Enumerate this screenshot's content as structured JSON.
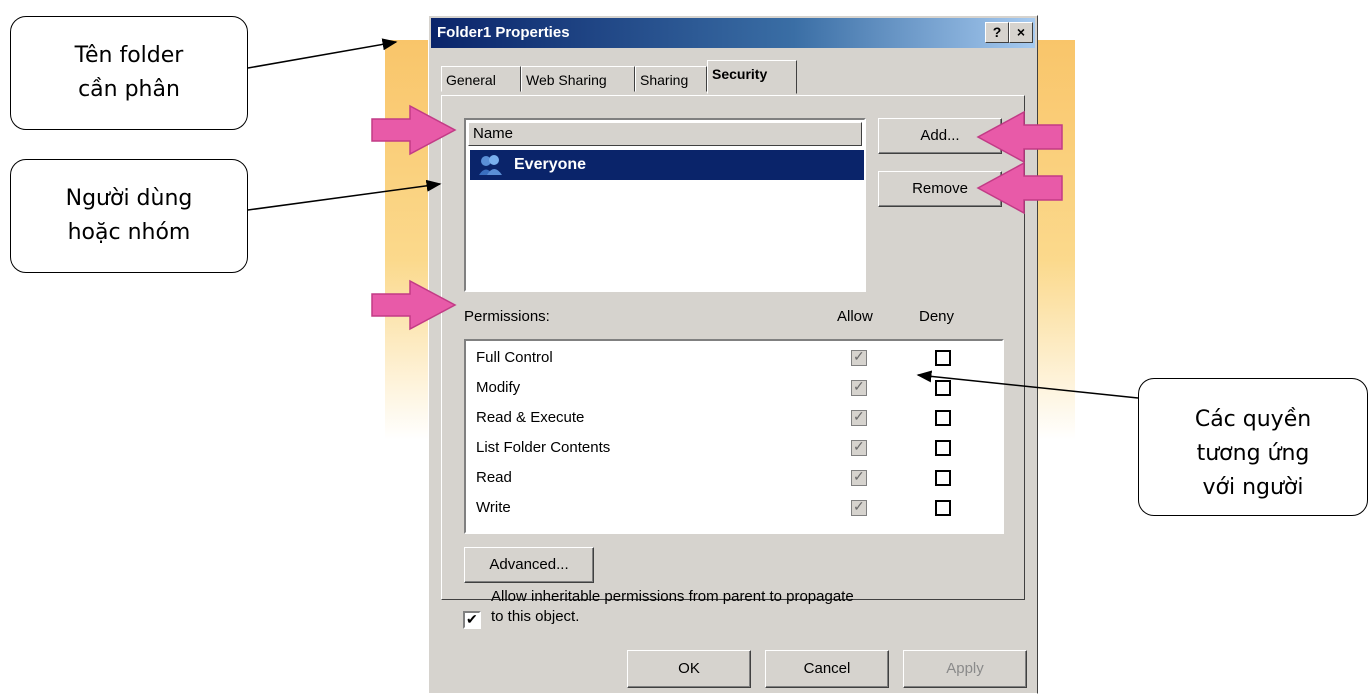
{
  "dialog": {
    "title": "Folder1 Properties",
    "help_button": "?",
    "close_button": "×",
    "tabs": [
      {
        "label": "General"
      },
      {
        "label": "Web Sharing"
      },
      {
        "label": "Sharing"
      },
      {
        "label": "Security"
      }
    ],
    "active_tab": "Security",
    "name_header": "Name",
    "users": [
      {
        "name": "Everyone",
        "selected": true
      }
    ],
    "add_button": "Add...",
    "remove_button": "Remove",
    "permissions_label": "Permissions:",
    "allow_header": "Allow",
    "deny_header": "Deny",
    "permissions": [
      {
        "name": "Full Control",
        "allow": true,
        "deny": false
      },
      {
        "name": "Modify",
        "allow": true,
        "deny": false
      },
      {
        "name": "Read & Execute",
        "allow": true,
        "deny": false
      },
      {
        "name": "List Folder Contents",
        "allow": true,
        "deny": false
      },
      {
        "name": "Read",
        "allow": true,
        "deny": false
      },
      {
        "name": "Write",
        "allow": true,
        "deny": false
      }
    ],
    "advanced_button": "Advanced...",
    "inherit_line1": "Allow inheritable permissions from parent to propagate",
    "inherit_line2": "to this object.",
    "inherit_checked": true,
    "ok_button": "OK",
    "cancel_button": "Cancel",
    "apply_button": "Apply"
  },
  "callouts": {
    "folder_name": {
      "line1": "Tên folder",
      "line2": "cần phân"
    },
    "user_group": {
      "line1": "Người dùng",
      "line2": "hoặc nhóm"
    },
    "permissions": {
      "line1": "Các quyền",
      "line2": "tương ứng",
      "line3": "với người"
    }
  },
  "colors": {
    "highlight_arrow": "#e85aa8",
    "title_bar": "#0a246a",
    "dialog_face": "#d6d3ce",
    "glow": "#f9c56a"
  }
}
